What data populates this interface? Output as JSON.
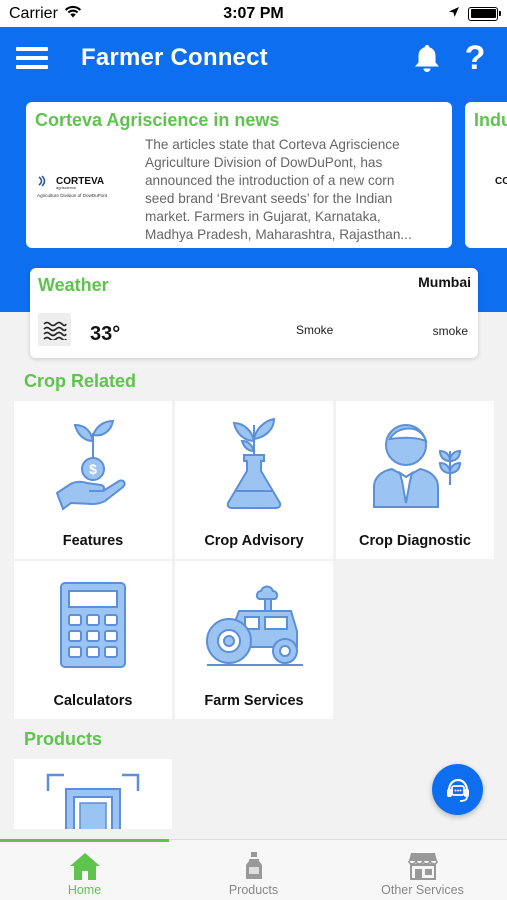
{
  "status_bar": {
    "carrier": "Carrier",
    "time": "3:07 PM"
  },
  "app_bar": {
    "title": "Farmer Connect"
  },
  "news": [
    {
      "title": "Corteva Agriscience in news",
      "logo_text": "CORTEVA",
      "logo_sub": "agriscience",
      "logo_caption": "Agriculture Division of DowDuPont",
      "lines": [
        "The articles state that Corteva Agriscience",
        "Agriculture Division of DowDuPont, has",
        "announced the introduction of a new corn",
        "seed brand ‘Brevant seeds’ for the Indian",
        "market. Farmers in Gujarat, Karnataka,",
        "Madhya Pradesh, Maharashtra, Rajasthan..."
      ]
    },
    {
      "title": "Indu",
      "logo_text": "CORTEVA"
    }
  ],
  "weather": {
    "title": "Weather",
    "city": "Mumbai",
    "temperature": "33°",
    "condition": "Smoke",
    "condition_detail": "smoke",
    "icon": "haze-icon"
  },
  "crop_related": {
    "title": "Crop Related",
    "tiles": [
      {
        "label": "Features",
        "icon": "money-plant-hand-icon"
      },
      {
        "label": "Crop Advisory",
        "icon": "flask-plant-icon"
      },
      {
        "label": "Crop Diagnostic",
        "icon": "expert-plant-icon"
      },
      {
        "label": "Calculators",
        "icon": "calculator-icon"
      },
      {
        "label": "Farm Services",
        "icon": "tractor-icon"
      }
    ]
  },
  "products": {
    "title": "Products",
    "icon": "scan-frame-icon"
  },
  "fab": {
    "icon": "support-headset-icon"
  },
  "tabs": [
    {
      "label": "Home",
      "icon": "home-icon",
      "active": true
    },
    {
      "label": "Products",
      "icon": "bottle-icon",
      "active": false
    },
    {
      "label": "Other Services",
      "icon": "store-icon",
      "active": false
    }
  ],
  "colors": {
    "primary_blue": "#0d6ff0",
    "accent_green": "#5ec44e",
    "icon_blue": "#9cc4f2",
    "icon_stroke": "#5b8fd8"
  }
}
